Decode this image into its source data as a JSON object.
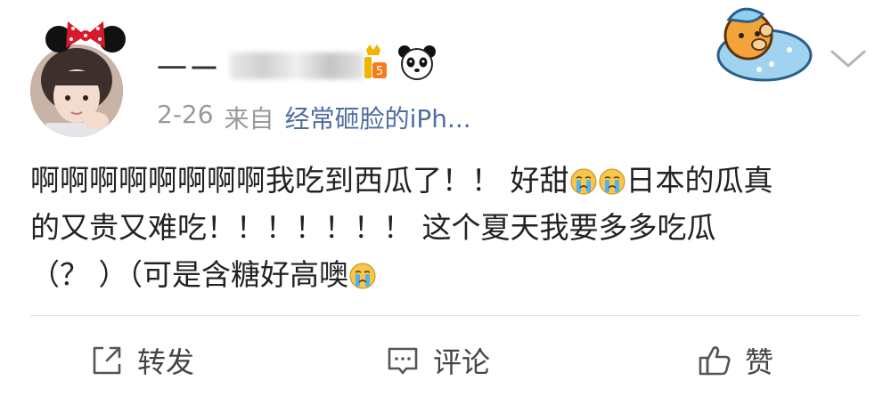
{
  "post": {
    "username_prefix": "一ー",
    "timestamp": "2-26",
    "source_prefix": "来自",
    "source_device": "经常砸脸的iPh...",
    "content_lines": [
      {
        "before": "啊啊啊啊啊啊啊啊我吃到西瓜了！！ 好甜",
        "after": "日本的瓜真"
      },
      {
        "text": "的又贵又难吃！！！！！！！ 这个夏天我要多多吃瓜"
      },
      {
        "before": "（？ ）（可是含糖好高噢",
        "after": ""
      }
    ],
    "emoji": "crying-face-emoji",
    "level_badge_number": "5"
  },
  "actions": {
    "repost_label": "转发",
    "comment_label": "评论",
    "like_label": "赞"
  },
  "colors": {
    "source_link": "#4e6e9e",
    "meta_gray": "#9a9a9a",
    "divider": "#e3e3e3"
  }
}
